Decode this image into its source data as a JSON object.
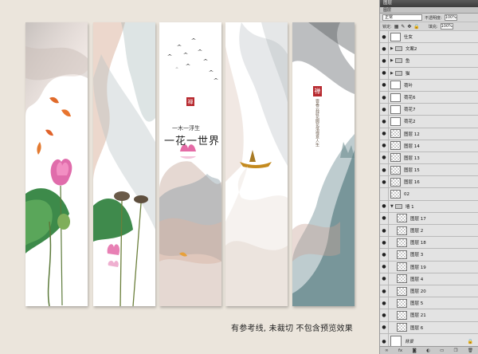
{
  "canvas": {
    "caption": "有参考线, 未裁切 不包含预览效果",
    "panel3": {
      "seal": "禅",
      "line_small": "一木一浮生",
      "line_big": "一花一世界"
    },
    "panel5": {
      "seal": "禅",
      "poem": "雲卷云舒花開花落禪意人生"
    }
  },
  "layers_panel": {
    "title": "图层",
    "tab": "图层",
    "blend_mode": "正常",
    "opacity_label": "不透明度:",
    "opacity_value": "100%",
    "lock_label": "锁定:",
    "fill_label": "填充:",
    "fill_value": "100%",
    "rows": [
      {
        "name": "仕女",
        "kind": "smart",
        "child": false
      },
      {
        "name": "文案2",
        "kind": "group",
        "child": false
      },
      {
        "name": "鱼",
        "kind": "group",
        "child": false
      },
      {
        "name": "猫",
        "kind": "group",
        "child": false
      },
      {
        "name": "荷叶",
        "kind": "smart",
        "child": false
      },
      {
        "name": "荷花6",
        "kind": "smart",
        "child": false
      },
      {
        "name": "荷花7",
        "kind": "smart",
        "child": false
      },
      {
        "name": "荷花2",
        "kind": "smart",
        "child": false
      },
      {
        "name": "图层 12",
        "kind": "layer",
        "child": false
      },
      {
        "name": "图层 14",
        "kind": "layer",
        "child": false
      },
      {
        "name": "图层 13",
        "kind": "layer",
        "child": false
      },
      {
        "name": "图层 15",
        "kind": "layer",
        "child": false
      },
      {
        "name": "图层 16",
        "kind": "layer",
        "child": false
      },
      {
        "name": "02",
        "kind": "layer",
        "child": false
      },
      {
        "name": "墙 1",
        "kind": "group",
        "child": false
      },
      {
        "name": "图层 17",
        "kind": "layer",
        "child": true
      },
      {
        "name": "图层 2",
        "kind": "layer",
        "child": true
      },
      {
        "name": "图层 18",
        "kind": "layer",
        "child": true
      },
      {
        "name": "图层 3",
        "kind": "layer",
        "child": true
      },
      {
        "name": "图层 19",
        "kind": "layer",
        "child": true
      },
      {
        "name": "图层 4",
        "kind": "layer",
        "child": true
      },
      {
        "name": "图层 20",
        "kind": "layer",
        "child": true
      },
      {
        "name": "图层 5",
        "kind": "layer",
        "child": true
      },
      {
        "name": "图层 21",
        "kind": "layer",
        "child": true
      },
      {
        "name": "图层 6",
        "kind": "layer",
        "child": true
      },
      {
        "name": "背景",
        "kind": "background",
        "child": false
      }
    ],
    "footer_icons": [
      "link-icon",
      "fx-icon",
      "mask-icon",
      "adjustment-icon",
      "folder-icon",
      "new-layer-icon",
      "trash-icon"
    ]
  }
}
